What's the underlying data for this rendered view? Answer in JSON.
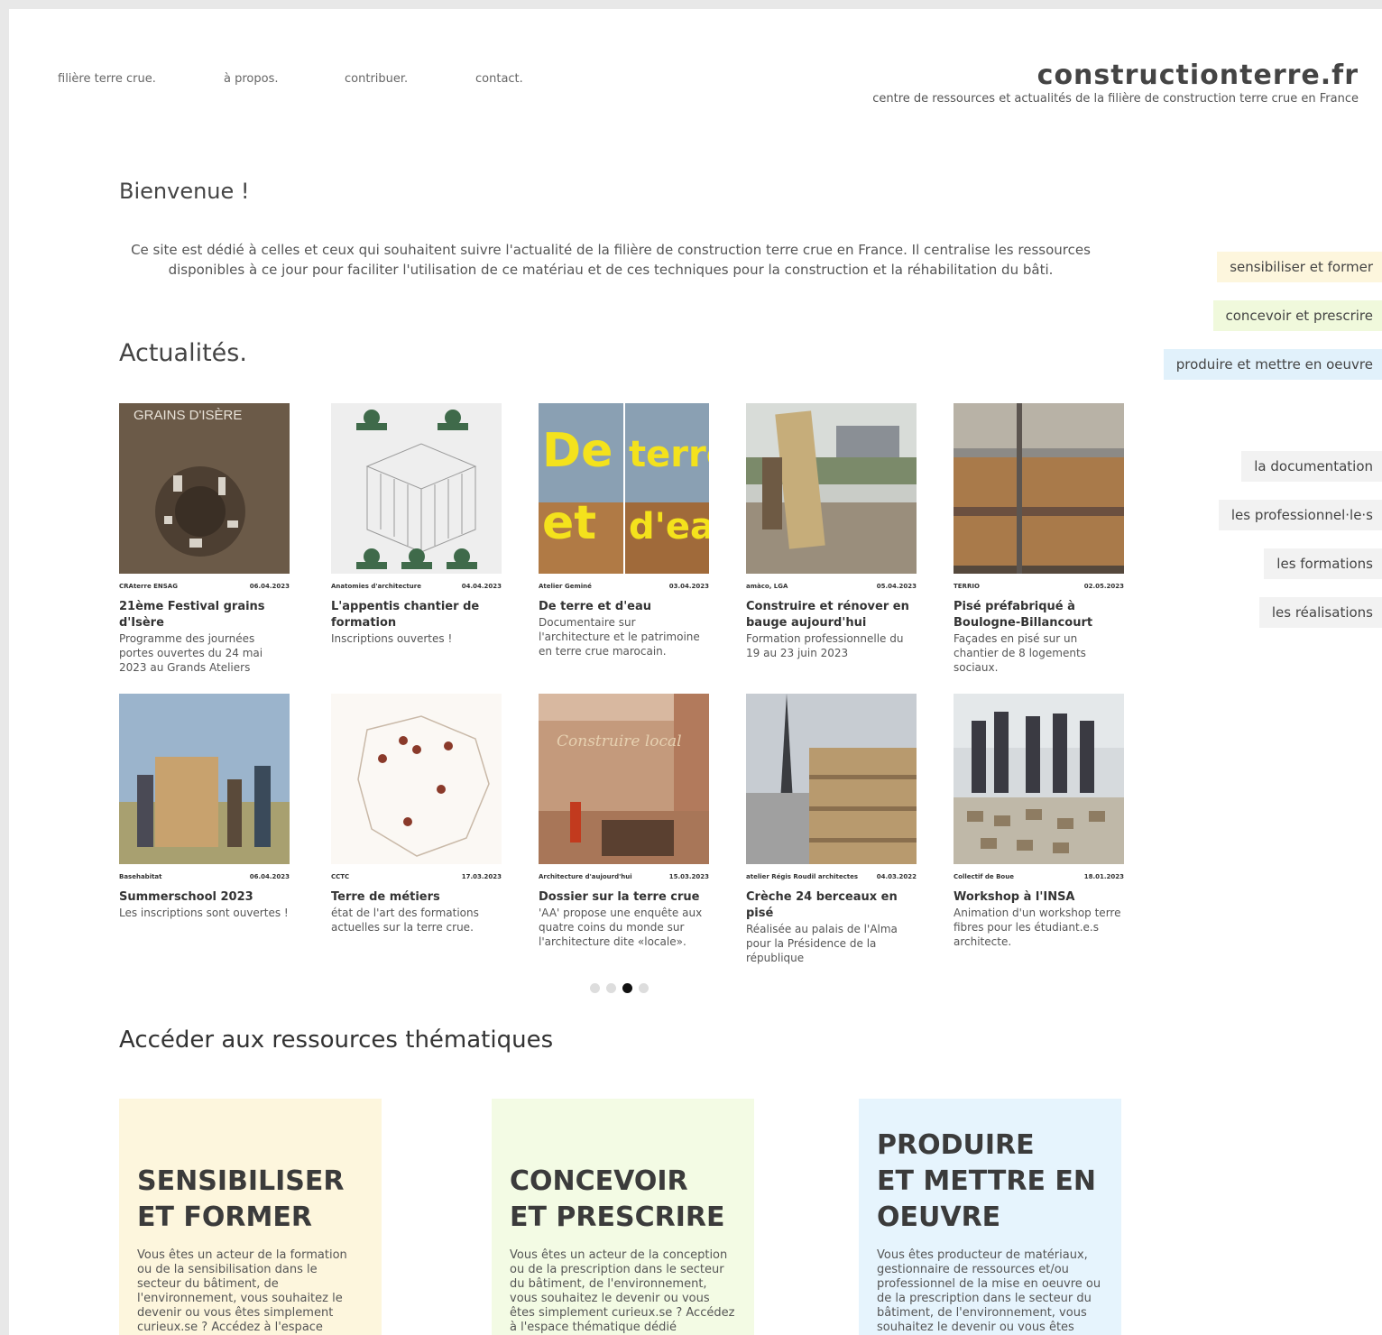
{
  "nav": {
    "items": [
      "filière terre crue.",
      "à propos.",
      "contribuer.",
      "contact."
    ]
  },
  "brand": {
    "name": "constructionterre.fr",
    "tagline": "centre de ressources et actualités de la filière de construction terre crue en France"
  },
  "welcome": {
    "title": "Bienvenue !",
    "intro": "Ce site est dédié à celles et ceux qui souhaitent suivre l'actualité de la filière de construction terre crue en France. Il centralise les ressources disponibles à ce jour pour faciliter l'utilisation de ce matériau et de ces techniques pour la construction et la réhabilitation du bâti."
  },
  "news": {
    "title": "Actualités.",
    "cards": [
      {
        "source": "CRAterre ENSAG",
        "date": "06.04.2023",
        "title": "21ème Festival grains d'Isère",
        "desc": "Programme des journées portes ouvertes du 24 mai 2023 au Grands Ateliers",
        "image_text": "GRAINS D'ISÈRE"
      },
      {
        "source": "Anatomies d'architecture",
        "date": "04.04.2023",
        "title": "L'appentis chantier de formation",
        "desc": "Inscriptions ouvertes !"
      },
      {
        "source": "Atelier Geminé",
        "date": "03.04.2023",
        "title": "De terre et d'eau",
        "desc": "Documentaire sur l'architecture et le patrimoine en terre crue marocain.",
        "image_text": "De et terre d'eau"
      },
      {
        "source": "amàco, LGA",
        "date": "05.04.2023",
        "title": "Construire et rénover en bauge aujourd'hui",
        "desc": "Formation professionnelle du 19 au 23 juin 2023"
      },
      {
        "source": "TERRIO",
        "date": "02.05.2023",
        "title": "Pisé préfabriqué à Boulogne-Billancourt",
        "desc": "Façades en pisé sur un chantier de 8 logements sociaux."
      },
      {
        "source": "Basehabitat",
        "date": "06.04.2023",
        "title": "Summerschool 2023",
        "desc": "Les inscriptions sont ouvertes !"
      },
      {
        "source": "CCTC",
        "date": "17.03.2023",
        "title": "Terre de métiers",
        "desc": "état de l'art des formations actuelles sur la terre crue."
      },
      {
        "source": "Architecture d'aujourd'hui",
        "date": "15.03.2023",
        "title": "Dossier sur la terre crue",
        "desc": "'AA' propose une enquête aux quatre coins du monde sur l'architecture dite «locale».",
        "image_text": "Construire local"
      },
      {
        "source": "atelier Régis Roudil architectes",
        "date": "04.03.2022",
        "title": "Crèche 24 berceaux en pisé",
        "desc": "Réalisée au palais de l'Alma pour la Présidence de la république"
      },
      {
        "source": "Collectif de Boue",
        "date": "18.01.2023",
        "title": "Workshop à l'INSA",
        "desc": "Animation d'un workshop terre fibres pour les étudiant.e.s architecte."
      }
    ]
  },
  "carousel": {
    "pages": 4,
    "active": 3
  },
  "sidebar": {
    "themes": [
      "sensibiliser et former",
      "concevoir et prescrire",
      "produire et mettre en oeuvre"
    ],
    "resources": [
      "la documentation",
      "les professionnel·le·s",
      "les formations",
      "les réalisations"
    ]
  },
  "resources": {
    "title": "Accéder aux ressources thématiques",
    "themes": [
      {
        "title_l1": "SENSIBILISER",
        "title_l2": "ET FORMER",
        "title_l3": "",
        "text": "Vous êtes un acteur de la formation ou de la sensibilisation dans le secteur du bâtiment, de l'environnement, vous souhaitez le devenir ou vous êtes simplement curieux.se ? Accédez à l'espace thématique dédié",
        "color": "#fdf6dd"
      },
      {
        "title_l1": "CONCEVOIR",
        "title_l2": "ET PRESCRIRE",
        "title_l3": "",
        "text": "Vous êtes un acteur de la conception ou de la prescription dans le secteur du bâtiment, de l'environnement, vous souhaitez le devenir ou vous êtes simplement curieux.se ? Accédez à l'espace thématique dédié",
        "color": "#f3fbe4"
      },
      {
        "title_l1": "PRODUIRE",
        "title_l2": "ET METTRE EN",
        "title_l3": "OEUVRE",
        "text": "Vous êtes producteur de matériaux, gestionnaire de ressources et/ou professionnel de la mise en oeuvre ou de la prescription dans le secteur du bâtiment, de l'environnement, vous souhaitez le devenir ou vous êtes",
        "color": "#e6f4fd"
      }
    ]
  }
}
